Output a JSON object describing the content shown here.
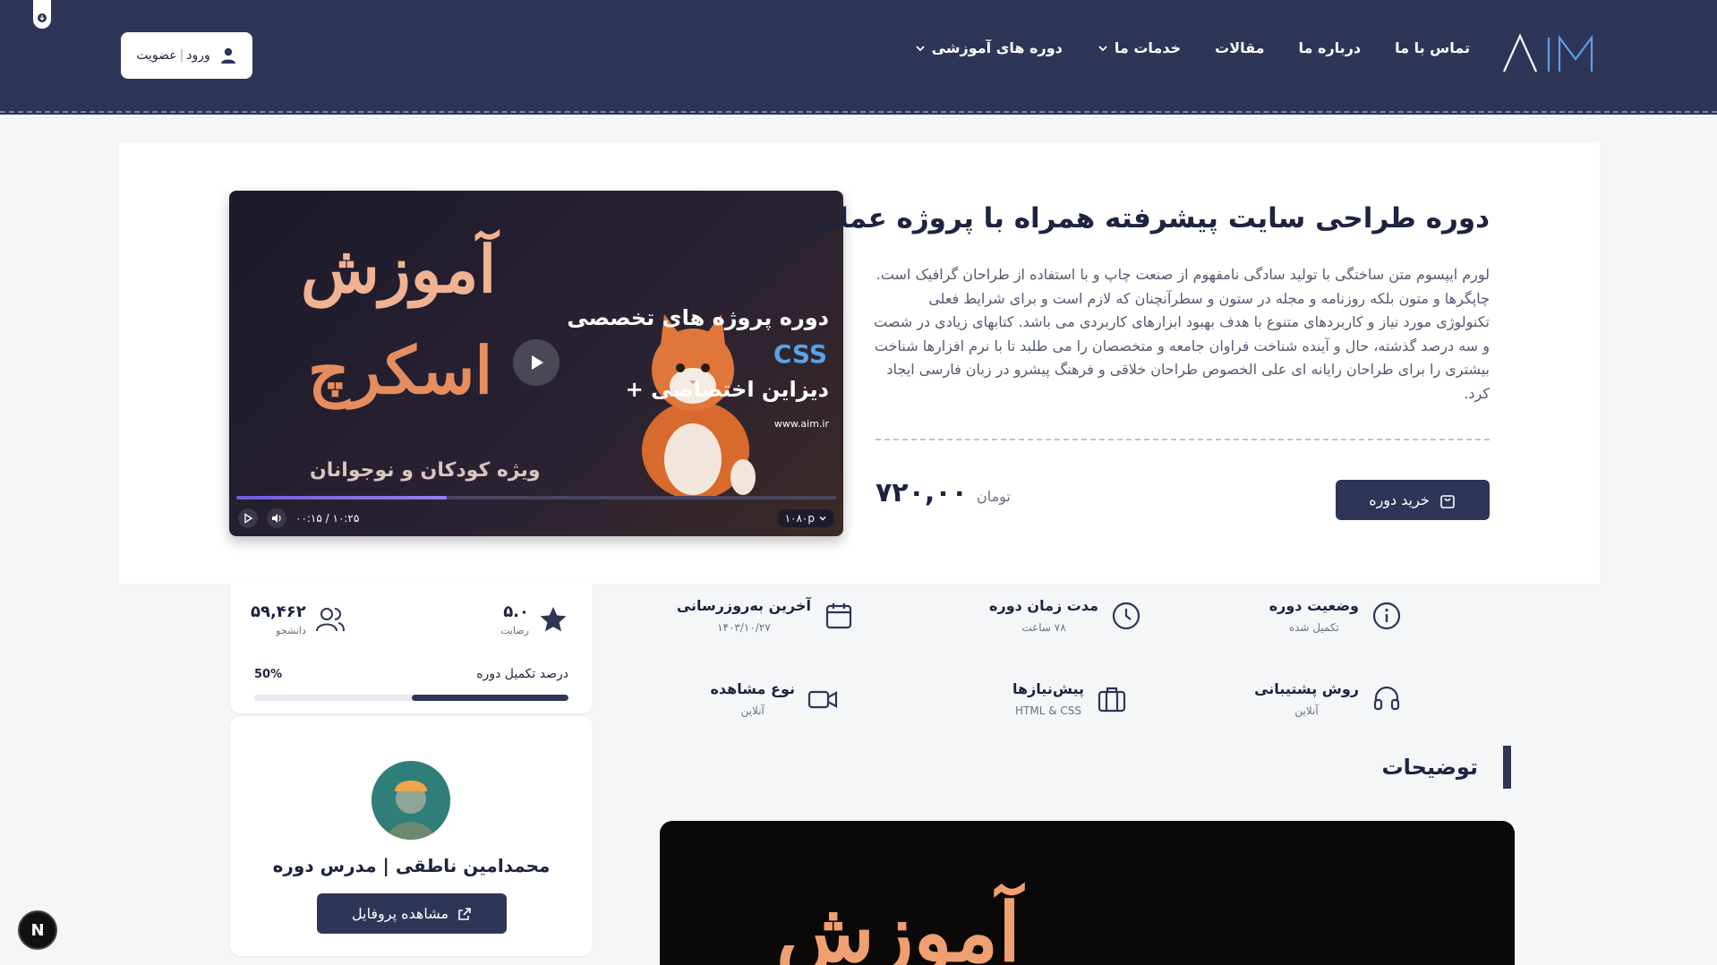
{
  "header": {
    "logo_text": "AIM",
    "nav": [
      {
        "label": "دوره های آموزشی",
        "has_dropdown": true
      },
      {
        "label": "خدمات ما",
        "has_dropdown": true
      },
      {
        "label": "مقالات",
        "has_dropdown": false
      },
      {
        "label": "درباره ما",
        "has_dropdown": false
      },
      {
        "label": "تماس با ما",
        "has_dropdown": false
      }
    ],
    "login_label": "ورود",
    "register_label": "عضویت",
    "login_separator": "|"
  },
  "course": {
    "title": "دوره طراحی سایت پیشرفته همراه با پروژه عملی",
    "description": "لورم ایپسوم متن ساختگی با تولید سادگی نامفهوم از صنعت چاپ و با استفاده از طراحان گرافیک است. چاپگرها و متون بلکه روزنامه و مجله در ستون و سطرآنچنان که لازم است و برای شرایط فعلی تکنولوژی مورد نیاز و کاربردهای متنوع با هدف بهبود ابزارهای کاربردی می باشد. کتابهای زیادی در شصت و سه درصد گذشته، حال و آینده شناخت فراوان جامعه و متخصصان را می طلبد تا با نرم افزارها شناخت بیشتری را برای طراحان رایانه ای علی الخصوص طراحان خلاقی و فرهنگ پیشرو در زبان فارسی ایجاد کرد.",
    "price": "۷۲۰,۰۰",
    "currency": "تومان",
    "buy_label": "خرید دوره"
  },
  "video": {
    "thumb_line1": "آموزش",
    "thumb_line2": "اسکرچ",
    "thumb_sub": "ویژه کودکان و نوجوانان",
    "thumb_right1": "دوره پروژه های تخصصی",
    "thumb_right2": "CSS",
    "thumb_right3": "دیزاین اختصاصی +",
    "thumb_url": "www.aim.ir",
    "time": "۰۰:۱۵ / ۱۰:۲۵",
    "quality": "۱۰۸۰p",
    "progress": 0.35
  },
  "stats": {
    "rating_value": "۵.۰",
    "rating_label": "رضایت",
    "students_value": "۵۹,۴۶۲",
    "students_label": "دانشجو",
    "completion_label": "درصد تکمیل دوره",
    "completion_pct": "50%",
    "completion_value": 0.5
  },
  "info": [
    {
      "title": "وضعیت دوره",
      "sub": "تکمیل شده",
      "icon": "info-circle-icon"
    },
    {
      "title": "مدت زمان دوره",
      "sub": "۷۸ ساعت",
      "icon": "clock-icon"
    },
    {
      "title": "آخرین به‌روزرسانی",
      "sub": "۱۴۰۳/۱۰/۲۷",
      "icon": "calendar-icon"
    },
    {
      "title": "روش پشتیبانی",
      "sub": "آنلاین",
      "icon": "headset-icon"
    },
    {
      "title": "پیش‌نیازها",
      "sub": "HTML & CSS",
      "icon": "briefcase-icon"
    },
    {
      "title": "نوع مشاهده",
      "sub": "آنلاین",
      "icon": "video-camera-icon"
    }
  ],
  "description_heading": "توضیحات",
  "teacher": {
    "name": "محمدامین ناطقی | مدرس دوره",
    "profile_label": "مشاهده پروفایل"
  },
  "bottom_video": {
    "text": "آموزش"
  },
  "badge": {
    "text": "N"
  },
  "colors": {
    "primary": "#2e3557",
    "accent": "#5aa1e6",
    "progress": "#7b63e0"
  }
}
